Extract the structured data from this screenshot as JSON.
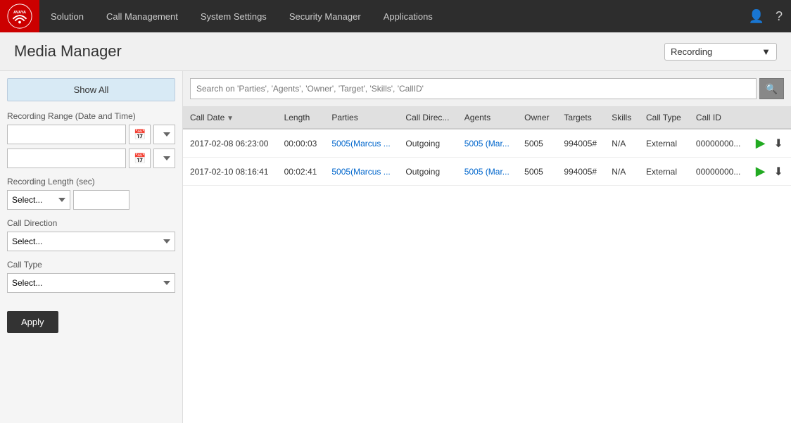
{
  "nav": {
    "logo_alt": "AVAYA",
    "items": [
      {
        "label": "Solution",
        "id": "solution"
      },
      {
        "label": "Call Management",
        "id": "call-management"
      },
      {
        "label": "System Settings",
        "id": "system-settings"
      },
      {
        "label": "Security Manager",
        "id": "security-manager"
      },
      {
        "label": "Applications",
        "id": "applications"
      }
    ],
    "user_icon": "👤",
    "help_icon": "?"
  },
  "page": {
    "title": "Media Manager",
    "dropdown_label": "Recording"
  },
  "sidebar": {
    "show_all_label": "Show All",
    "recording_range_label": "Recording Range (Date and Time)",
    "start_date_placeholder": "",
    "end_date_placeholder": "",
    "recording_length_label": "Recording Length (sec)",
    "length_select_placeholder": "Select...",
    "call_direction_label": "Call Direction",
    "call_direction_placeholder": "Select...",
    "call_type_label": "Call Type",
    "call_type_placeholder": "Select...",
    "apply_label": "Apply"
  },
  "search": {
    "placeholder": "Search on 'Parties', 'Agents', 'Owner', 'Target', 'Skills', 'CallID'"
  },
  "table": {
    "columns": [
      {
        "label": "Call Date",
        "sortable": true
      },
      {
        "label": "Length",
        "sortable": false
      },
      {
        "label": "Parties",
        "sortable": false
      },
      {
        "label": "Call Direc...",
        "sortable": false
      },
      {
        "label": "Agents",
        "sortable": false
      },
      {
        "label": "Owner",
        "sortable": false
      },
      {
        "label": "Targets",
        "sortable": false
      },
      {
        "label": "Skills",
        "sortable": false
      },
      {
        "label": "Call Type",
        "sortable": false
      },
      {
        "label": "Call ID",
        "sortable": false
      },
      {
        "label": "",
        "sortable": false
      }
    ],
    "rows": [
      {
        "call_date": "2017-02-08 06:23:00",
        "length": "00:00:03",
        "parties": "5005(Marcus ...",
        "call_direction": "Outgoing",
        "agents": "5005 (Mar...",
        "owner": "5005",
        "targets": "994005#",
        "skills": "N/A",
        "call_type": "External",
        "call_id": "00000000..."
      },
      {
        "call_date": "2017-02-10 08:16:41",
        "length": "00:02:41",
        "parties": "5005(Marcus ...",
        "call_direction": "Outgoing",
        "agents": "5005 (Mar...",
        "owner": "5005",
        "targets": "994005#",
        "skills": "N/A",
        "call_type": "External",
        "call_id": "00000000..."
      }
    ]
  }
}
